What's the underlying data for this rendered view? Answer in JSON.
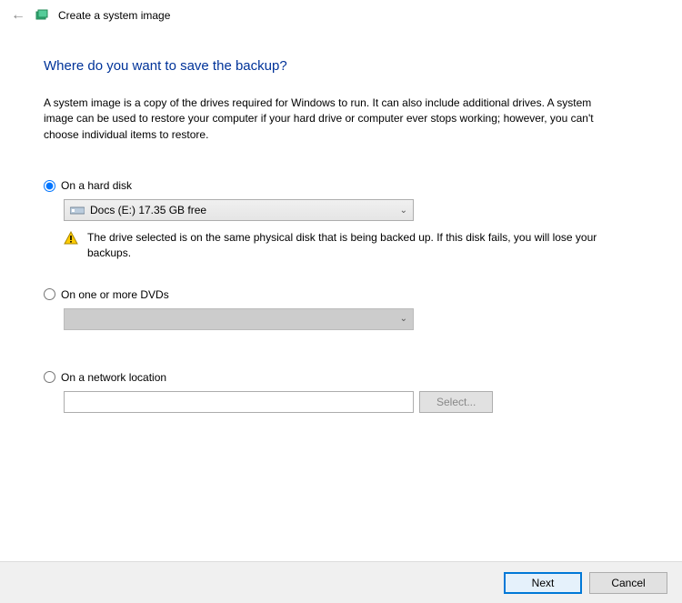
{
  "titlebar": {
    "title": "Create a system image"
  },
  "main": {
    "heading": "Where do you want to save the backup?",
    "description": "A system image is a copy of the drives required for Windows to run. It can also include additional drives. A system image can be used to restore your computer if your hard drive or computer ever stops working; however, you can't choose individual items to restore."
  },
  "options": {
    "hard_disk": {
      "label": "On a hard disk",
      "selected_drive": "Docs (E:)  17.35 GB free",
      "warning": "The drive selected is on the same physical disk that is being backed up. If this disk fails, you will lose your backups."
    },
    "dvd": {
      "label": "On one or more DVDs"
    },
    "network": {
      "label": "On a network location",
      "value": "",
      "select_button": "Select..."
    }
  },
  "footer": {
    "next": "Next",
    "cancel": "Cancel"
  }
}
